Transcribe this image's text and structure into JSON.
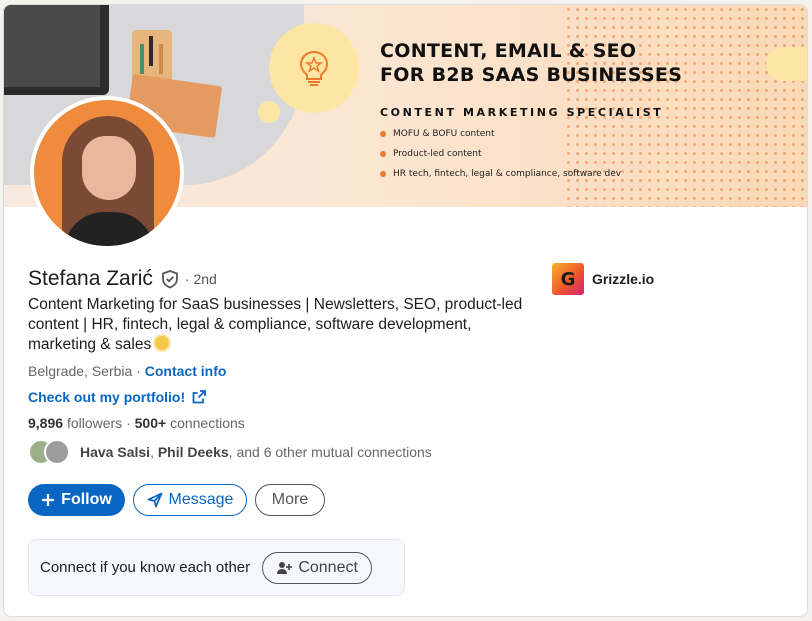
{
  "banner": {
    "title_line1": "CONTENT, EMAIL & SEO",
    "title_line2": "FOR B2B SAAS BUSINESSES",
    "subtitle": "CONTENT MARKETING SPECIALIST",
    "bullets": [
      "MOFU  & BOFU content",
      "Product-led content",
      "HR tech, fintech, legal & compliance, software dev"
    ],
    "accent_color": "#ee7a2c"
  },
  "profile": {
    "name": "Stefana Zarić",
    "degree": "· 2nd",
    "headline": "Content Marketing for SaaS businesses | Newsletters, SEO, product-led content | HR, fintech, legal & compliance, software development, marketing & sales",
    "location": "Belgrade, Serbia",
    "location_sep": " · ",
    "contact_info": "Contact info",
    "portfolio_link": "Check out my portfolio!",
    "followers": "9,896",
    "followers_label": "followers",
    "stats_sep": " · ",
    "connections": "500+",
    "connections_label": "connections",
    "mutual": {
      "name1": "Hava Salsi",
      "sep": ", ",
      "name2": "Phil Deeks",
      "rest": ", and 6 other mutual connections"
    }
  },
  "company": {
    "logo_letter": "G",
    "name": "Grizzle.io"
  },
  "actions": {
    "follow": "Follow",
    "message": "Message",
    "more": "More"
  },
  "connect_prompt": {
    "text": "Connect if you know each other",
    "button": "Connect"
  },
  "colors": {
    "primary": "#0a66c2",
    "text": "#1d1d1d",
    "muted": "#666666"
  }
}
